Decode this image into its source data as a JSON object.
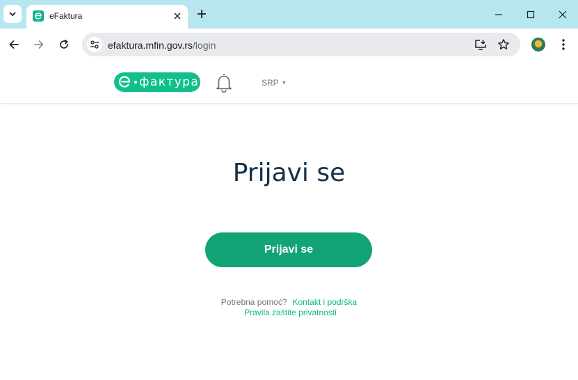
{
  "browser": {
    "tab": {
      "title": "eFaktura"
    },
    "address": {
      "domain": "efaktura.mfin.gov.rs",
      "path": "/login"
    }
  },
  "header": {
    "logo_text": "фактура",
    "language": "SRP"
  },
  "main": {
    "title": "Prijavi se",
    "login_button": "Prijavi se",
    "help_label": "Potrebna pomoć?",
    "contact_link": "Kontakt i podrška",
    "privacy_link": "Pravila zaštite privatnosti"
  },
  "colors": {
    "tabbar": "#b7e6f0",
    "brand_green": "#0fc08a",
    "button_green": "#12a376",
    "heading": "#13304a",
    "link": "#0fb58a"
  }
}
